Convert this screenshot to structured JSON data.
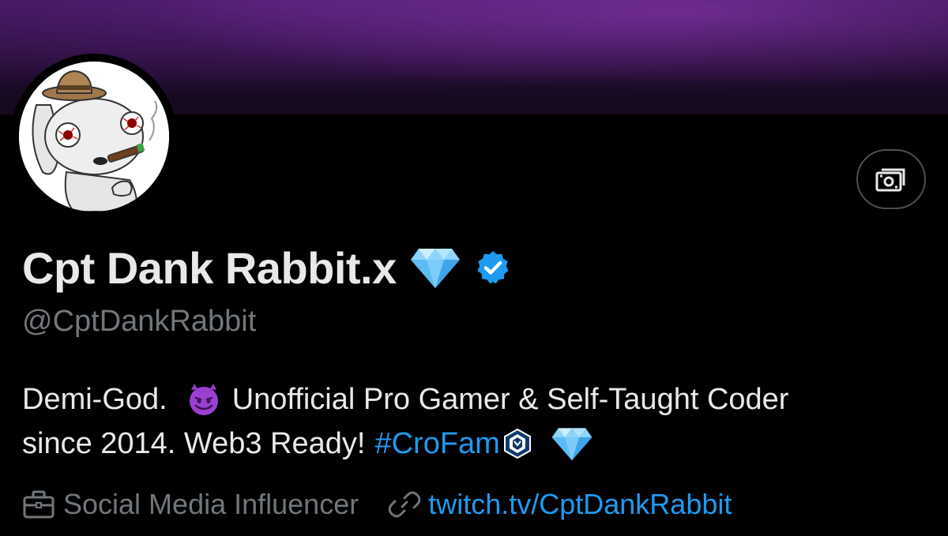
{
  "profile": {
    "display_name": "Cpt Dank Rabbit.x",
    "handle": "@CptDankRabbit",
    "bio_line1_a": "Demi-God.",
    "bio_line1_b": "Unofficial Pro Gamer & Self-Taught Coder",
    "bio_line2_a": "since 2014. Web3 Ready!",
    "bio_hashtag": "#CroFam",
    "category": "Social Media Influencer",
    "website": "twitch.tv/CptDankRabbit"
  },
  "icons": {
    "verified": "verified-badge-icon",
    "diamond": "gem-icon",
    "devil": "smiling-devil-emoji",
    "cro": "cronos-logo-icon",
    "briefcase": "briefcase-icon",
    "link": "link-icon",
    "tip": "money-tip-icon"
  },
  "colors": {
    "accent": "#1d9bf0",
    "muted": "#71767b",
    "text": "#e7e9ea",
    "banner": "#2a0f3d"
  }
}
